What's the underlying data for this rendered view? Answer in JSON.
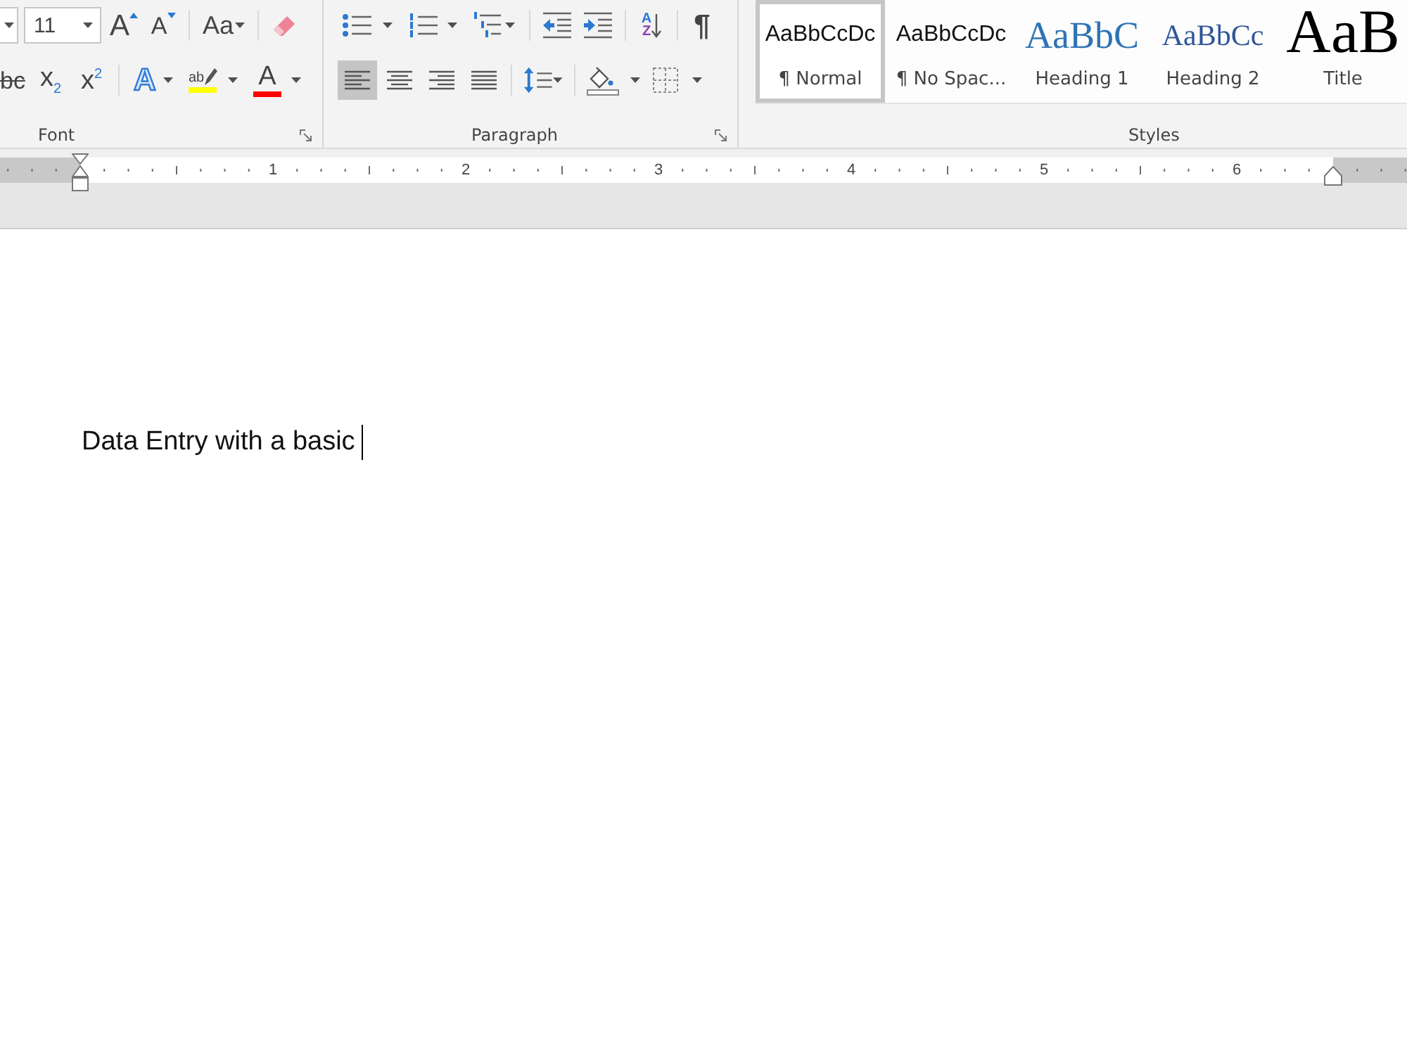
{
  "ribbon": {
    "font_group": {
      "label": "Font",
      "row_1": [
        {
          "kind": "font-name"
        },
        {
          "kind": "font-size",
          "value": "11"
        },
        {
          "kind": "grow",
          "glyph": "A",
          "dropdown": false
        },
        {
          "kind": "shrink",
          "glyph": "A",
          "dropdown": false
        },
        {
          "kind": "separator"
        },
        {
          "kind": "change-case",
          "glyph": "Aa",
          "dropdown": true
        },
        {
          "kind": "separator"
        },
        {
          "kind": "clear-formatting",
          "dropdown": false
        }
      ],
      "row_2": [
        {
          "kind": "strikethrough",
          "glyph": "bc",
          "dropdown": false
        },
        {
          "kind": "subscript",
          "glyph": "x$_{2}$",
          "dropdown": false
        },
        {
          "kind": "superscript",
          "glyph": "x$^{2}$",
          "dropdown": false
        },
        {
          "kind": "separator"
        },
        {
          "kind": "text-effects",
          "glyph": "A",
          "dropdown": true
        },
        {
          "kind": "highlight",
          "glyph": "ab",
          "color": "#ffff00",
          "dropdown": true
        },
        {
          "kind": "font-color",
          "glyph": "A",
          "color": "#ff0000",
          "dropdown": true
        }
      ]
    },
    "paragraph_group": {
      "label": "Paragraph",
      "row_1": [
        {
          "kind": "bullets",
          "dropdown": true
        },
        {
          "kind": "numbering",
          "dropdown": true
        },
        {
          "kind": "multilevel",
          "dropdown": true
        },
        {
          "kind": "separator"
        },
        {
          "kind": "decrease-indent",
          "dropdown": false
        },
        {
          "kind": "increase-indent",
          "dropdown": false
        },
        {
          "kind": "separator"
        },
        {
          "kind": "sort",
          "glyph": "A",
          "glyph_2": "Z",
          "dropdown": false
        },
        {
          "kind": "separator"
        },
        {
          "kind": "show-marks",
          "glyph": "¶",
          "dropdown": false
        }
      ],
      "alignment": [
        {
          "kind": "left",
          "selected": true
        },
        {
          "kind": "center",
          "selected": false
        },
        {
          "kind": "right",
          "selected": false
        },
        {
          "kind": "justify",
          "selected": false
        }
      ],
      "row_2": [
        {
          "kind": "separator"
        },
        {
          "kind": "line-spacing",
          "dropdown": true
        },
        {
          "kind": "separator"
        },
        {
          "kind": "shading",
          "dropdown": true
        },
        {
          "kind": "borders",
          "dropdown": true
        }
      ]
    },
    "styles_group": {
      "label": "Styles",
      "items": [
        {
          "kind": "normal",
          "preview": "AaBbCcDc",
          "name": "¶ Normal",
          "selected": true
        },
        {
          "kind": "no-spacing",
          "preview": "AaBbCcDc",
          "name": "¶ No Spac...",
          "selected": false
        },
        {
          "kind": "heading-1",
          "preview": "AaBbC",
          "name": "Heading 1",
          "selected": false
        },
        {
          "kind": "heading-2",
          "preview": "AaBbCc",
          "name": "Heading 2",
          "selected": false
        },
        {
          "kind": "title",
          "preview": "AaB",
          "name": "Title",
          "selected": false
        }
      ]
    }
  },
  "ruler": {
    "labels": [
      "1",
      "2",
      "3",
      "4",
      "5",
      "6"
    ]
  },
  "document": {
    "text": "Data Entry with a basic"
  }
}
